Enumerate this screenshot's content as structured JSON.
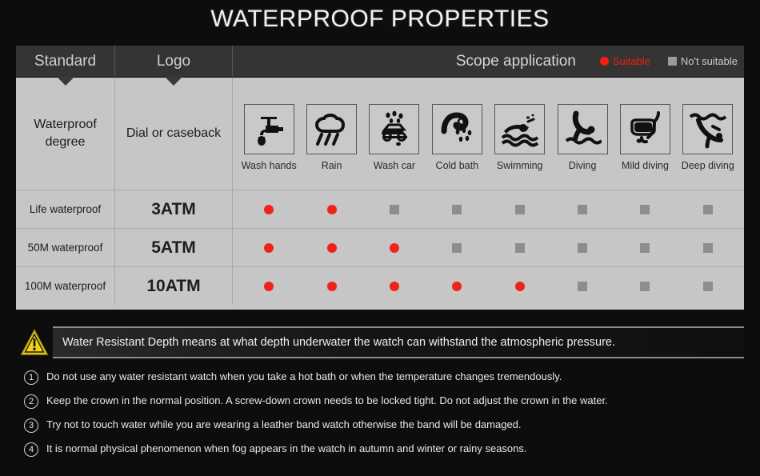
{
  "page": {
    "title": "WATERPROOF PROPERTIES",
    "background_color": "#0d0d0d",
    "accent_red": "#f0231a",
    "accent_gray": "#8e8e8e",
    "warning_yellow": "#f5d312"
  },
  "table": {
    "header": {
      "standard": "Standard",
      "logo": "Logo",
      "scope": "Scope application",
      "legend": [
        {
          "marker": "red-dot",
          "label": "Suitable",
          "color": "#f01e14"
        },
        {
          "marker": "gray-square",
          "label": "No't  suitable",
          "color": "#cccccc"
        }
      ]
    },
    "subheader": {
      "standard": "Waterproof degree",
      "standard_line1": "Waterproof",
      "standard_line2": "degree",
      "logo": "Dial or caseback"
    },
    "activities": [
      {
        "label": "Wash hands",
        "icon": "faucet-icon"
      },
      {
        "label": "Rain",
        "icon": "rain-cloud-icon"
      },
      {
        "label": "Wash car",
        "icon": "car-wash-icon"
      },
      {
        "label": "Cold bath",
        "icon": "shower-head-icon"
      },
      {
        "label": "Swimming",
        "icon": "swimmer-icon"
      },
      {
        "label": "Diving",
        "icon": "diver-icon"
      },
      {
        "label": "Mild diving",
        "icon": "snorkel-mask-icon"
      },
      {
        "label": "Deep diving",
        "icon": "deep-diver-icon"
      }
    ],
    "rows": [
      {
        "standard": "Life waterproof",
        "logo": "3ATM",
        "marks": [
          "yes",
          "yes",
          "no",
          "no",
          "no",
          "no",
          "no",
          "no"
        ]
      },
      {
        "standard": "50M waterproof",
        "logo": "5ATM",
        "marks": [
          "yes",
          "yes",
          "yes",
          "no",
          "no",
          "no",
          "no",
          "no"
        ]
      },
      {
        "standard": "100M waterproof",
        "logo": "10ATM",
        "marks": [
          "yes",
          "yes",
          "yes",
          "yes",
          "yes",
          "no",
          "no",
          "no"
        ]
      }
    ]
  },
  "warning": {
    "icon": "warning-triangle-icon",
    "text": "Water Resistant Depth means at what depth underwater the watch can withstand the atmospheric pressure."
  },
  "notes": [
    {
      "number": "①",
      "text": "Do not use any water resistant watch when you take a hot bath or when the temperature changes tremendously."
    },
    {
      "number": "②",
      "text": "Keep the crown in the normal position. A screw-down crown needs to be locked tight. Do not adjust the crown in the water."
    },
    {
      "number": "③",
      "text": "Try not to touch water while you are wearing a leather band watch otherwise the band will be damaged."
    },
    {
      "number": "④",
      "text": "It is normal physical phenomenon when fog appears in the watch in autumn and winter or rainy seasons."
    }
  ]
}
